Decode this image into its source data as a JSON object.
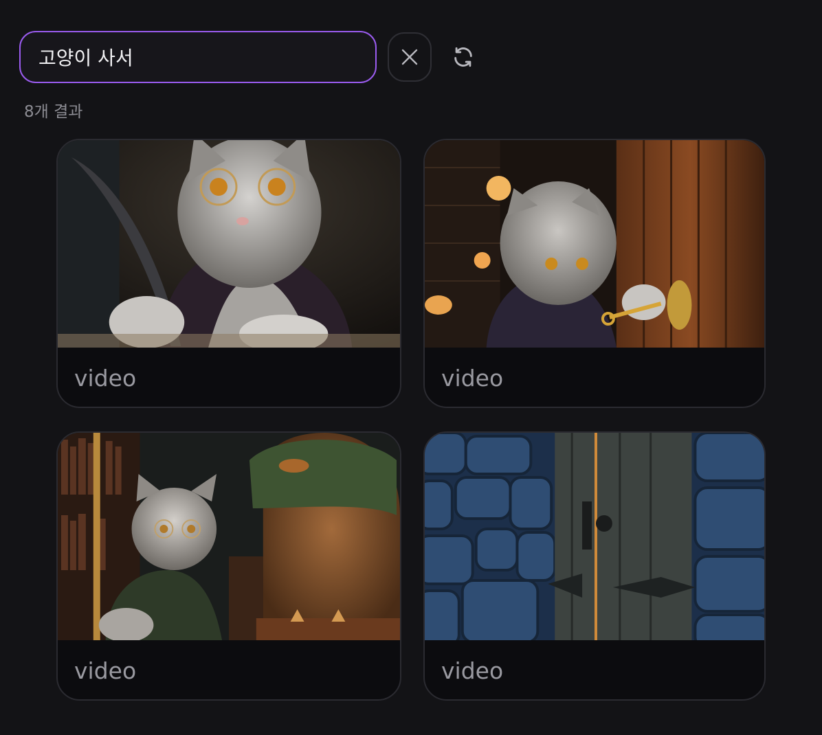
{
  "search": {
    "value": "고양이 사서",
    "accent_color": "#9b5cf0"
  },
  "toolbar": {
    "clear_icon": "close-icon",
    "refresh_icon": "refresh-icon"
  },
  "results": {
    "count_label": "8개 결과",
    "items": [
      {
        "label": "video",
        "thumbnail": "cat-librarian-writing-with-quill"
      },
      {
        "label": "video",
        "thumbnail": "cat-librarian-unlocking-door-with-key"
      },
      {
        "label": "video",
        "thumbnail": "kitten-and-owl-in-library"
      },
      {
        "label": "video",
        "thumbnail": "wooden-door-in-stone-wall"
      }
    ]
  }
}
